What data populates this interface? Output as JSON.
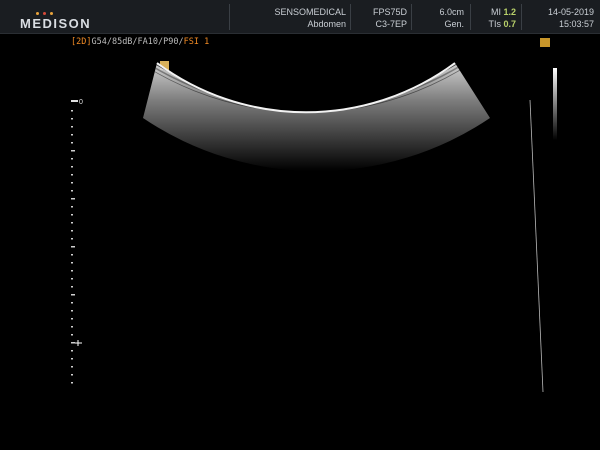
{
  "header": {
    "logo": "MEDISON",
    "logo_dot_colors": [
      "#e8a33b",
      "#d84a3a",
      "#e8a33b"
    ],
    "institution": "SENSOMEDICAL",
    "exam": "Abdomen",
    "preset": "FPS75D",
    "probe": "C3-7EP",
    "depth": "6.0cm",
    "mode": "Gen.",
    "mi_label": "MI",
    "mi_value": "1.2",
    "tis_label": "TIs",
    "tis_value": "0.7",
    "date": "14-05-2019",
    "time": "15:03:57"
  },
  "status_line": {
    "mode_tag": "[2D]",
    "params": "G54/85dB/FA10/P90/",
    "fsi": "FSI 1"
  },
  "depth_scale": {
    "zero_label": "0"
  },
  "colors": {
    "accent_orange": "#f08a24",
    "highlight_green": "#b8d06a",
    "marker_yellow": "#d9b15a"
  }
}
